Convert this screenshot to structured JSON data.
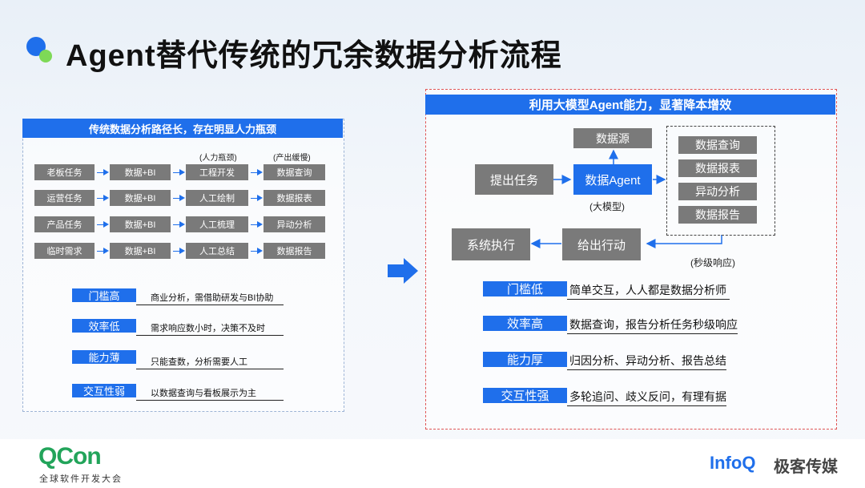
{
  "title": "Agent替代传统的冗余数据分析流程",
  "left": {
    "header": "传统数据分析路径长，存在明显人力瓶颈",
    "notes": [
      "(人力瓶颈)",
      "(产出缓慢)"
    ],
    "rows": [
      [
        "老板任务",
        "数据+BI",
        "工程开发",
        "数据查询"
      ],
      [
        "运营任务",
        "数据+BI",
        "人工绘制",
        "数据报表"
      ],
      [
        "产品任务",
        "数据+BI",
        "人工梳理",
        "异动分析"
      ],
      [
        "临时需求",
        "数据+BI",
        "人工总结",
        "数据报告"
      ]
    ],
    "issues": [
      {
        "label": "门槛高",
        "desc": "商业分析，需借助研发与BI协助"
      },
      {
        "label": "效率低",
        "desc": "需求响应数小时，决策不及时"
      },
      {
        "label": "能力薄",
        "desc": "只能查数，分析需要人工"
      },
      {
        "label": "交互性弱",
        "desc": "以数据查询与看板展示为主"
      }
    ]
  },
  "right": {
    "header": "利用大模型Agent能力，显著降本增效",
    "flow": {
      "submit": "提出任务",
      "agent": "数据Agent",
      "agent_note": "(大模型)",
      "source": "数据源",
      "outputs": [
        "数据查询",
        "数据报表",
        "异动分析",
        "数据报告"
      ],
      "action": "给出行动",
      "exec": "系统执行",
      "response_note": "(秒级响应)"
    },
    "benefits": [
      {
        "label": "门槛低",
        "desc": "简单交互，人人都是数据分析师"
      },
      {
        "label": "效率高",
        "desc": "数据查询，报告分析任务秒级响应"
      },
      {
        "label": "能力厚",
        "desc": "归因分析、异动分析、报告总结"
      },
      {
        "label": "交互性强",
        "desc": "多轮追问、歧义反问，有理有据"
      }
    ]
  },
  "footer": {
    "qcon_logo": "QCon",
    "qcon_sub": "全球软件开发大会",
    "infoq_logo": "InfoQ",
    "infoq_sub": "极客传媒"
  },
  "colors": {
    "accent": "#1f6feb",
    "gray_box": "#7a7a7a",
    "red_border": "#e05454",
    "green": "#22a45a"
  }
}
